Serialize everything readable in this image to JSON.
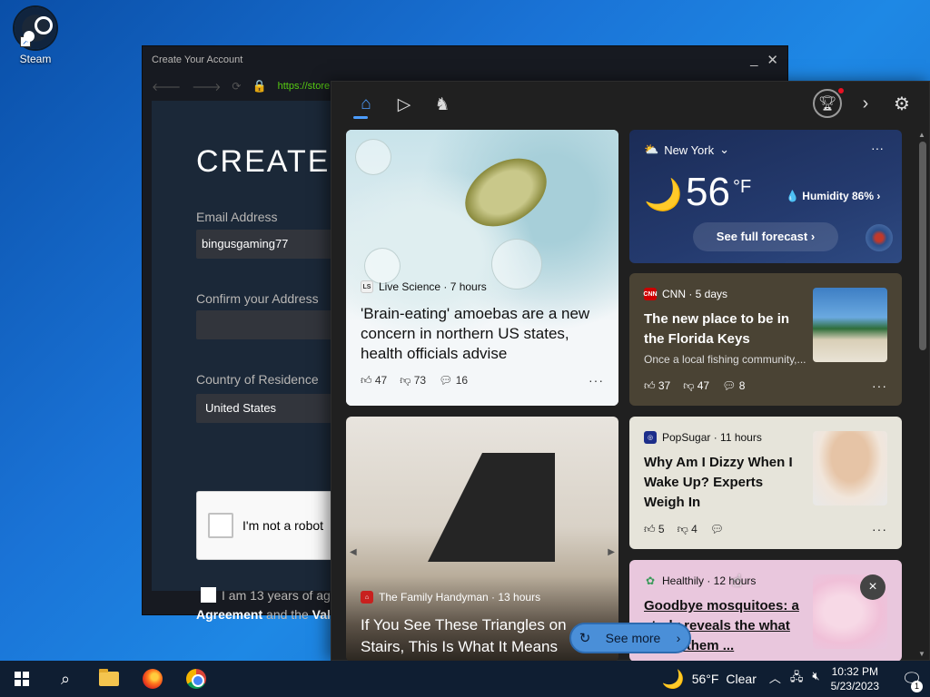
{
  "desktop": {
    "icons": [
      {
        "label": "Steam"
      }
    ]
  },
  "steam_window": {
    "title": "Create Your Account",
    "url": "https://store.steampowered.com/join/?l=english",
    "heading": "CREATE Y",
    "email_label": "Email Address",
    "email_value": "bingusgaming77",
    "confirm_label": "Confirm your Address",
    "confirm_value": "",
    "country_label": "Country of Residence",
    "country_value": "United States",
    "captcha_label": "I'm not a robot",
    "agree_line1": "I am 13 years of ag",
    "agree_line2_bold1": "Agreement",
    "agree_line2_mid": " and the ",
    "agree_line2_bold2": "Val"
  },
  "widgets": {
    "tabs": [
      {
        "icon": "home-icon"
      },
      {
        "icon": "video-icon"
      },
      {
        "icon": "game-icon"
      }
    ],
    "weather": {
      "location": "New York",
      "temp": "56",
      "unit": "°F",
      "humidity_label": "Humidity 86%",
      "forecast_button": "See full forecast"
    },
    "cards": {
      "amoeba": {
        "source": "Live Science · 7 hours",
        "headline": "'Brain-eating' amoebas are a new concern in northern US states, health officials advise",
        "likes": "47",
        "dislikes": "73",
        "comments": "16"
      },
      "cnn": {
        "source_logo": "CNN",
        "source": "CNN · 5 days",
        "headline": "The new place to be in the Florida Keys",
        "sub": "Once a local fishing community,...",
        "likes": "37",
        "dislikes": "47",
        "comments": "8"
      },
      "popsugar": {
        "source": "PopSugar · 11 hours",
        "headline": "Why Am I Dizzy When I Wake Up? Experts Weigh In",
        "likes": "5",
        "dislikes": "4",
        "comments": ""
      },
      "handyman": {
        "source": "The Family Handyman · 13 hours",
        "headline": "If You See These Triangles on Stairs, This Is What It Means"
      },
      "healthily": {
        "source": "Healthily · 12 hours",
        "headline": "Goodbye mosquitoes: a study reveals the what keeps them ..."
      }
    },
    "see_more": "See more"
  },
  "taskbar": {
    "weather_temp": "56°F",
    "weather_cond": "Clear",
    "time": "10:32 PM",
    "date": "5/23/2023",
    "notifications": "1"
  }
}
